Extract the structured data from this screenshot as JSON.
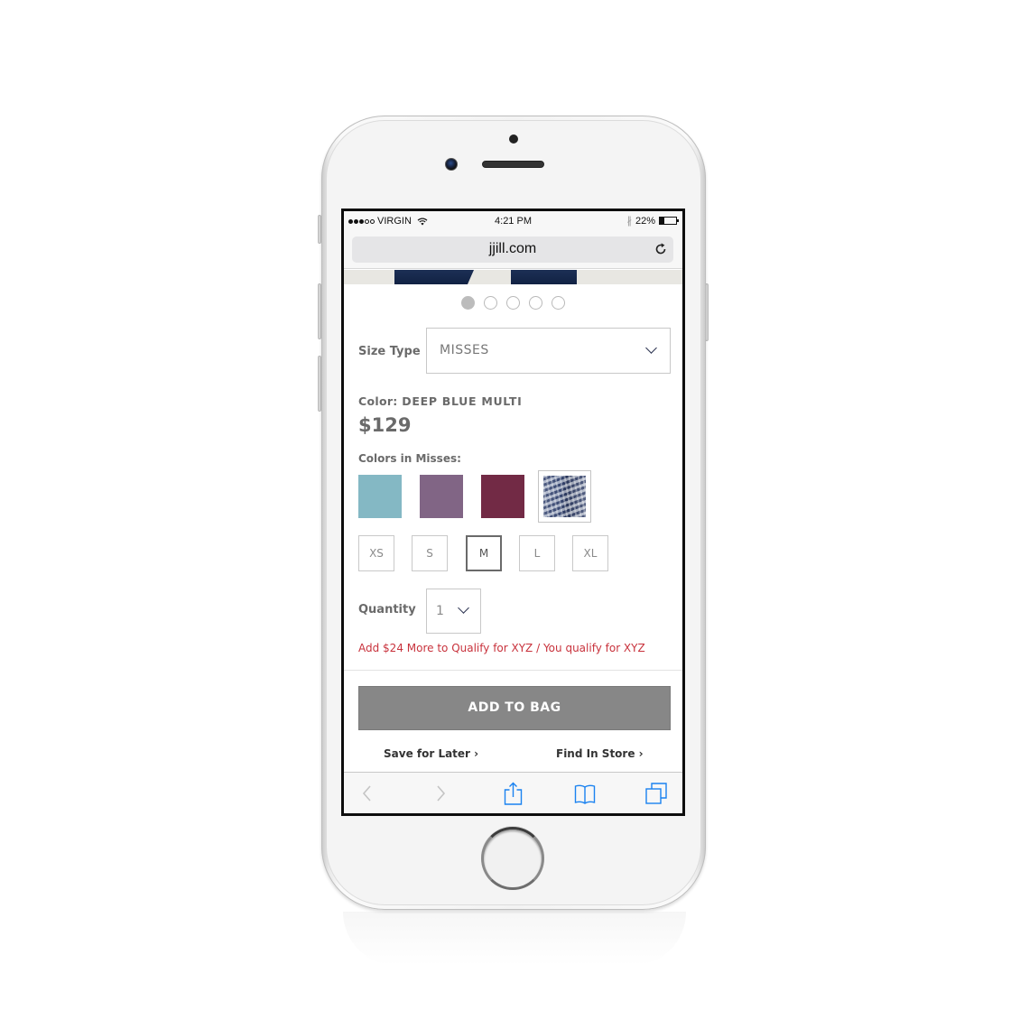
{
  "status_bar": {
    "carrier": "VIRGIN",
    "signal_bars_filled": 3,
    "signal_bars_total": 5,
    "time": "4:21 PM",
    "battery_percent": "22%",
    "icons": [
      "wifi-icon",
      "bluetooth-icon",
      "battery-icon"
    ]
  },
  "browser": {
    "url": "jjill.com",
    "reload_icon": "reload-icon",
    "toolbar": [
      "back-icon",
      "forward-icon",
      "share-icon",
      "bookmarks-icon",
      "tabs-icon"
    ]
  },
  "carousel": {
    "total_pages": 5,
    "active_page": 1
  },
  "product": {
    "size_type_label": "Size Type",
    "size_type_value": "MISSES",
    "color_label": "Color:",
    "color_name": "DEEP BLUE MULTI",
    "price": "$129",
    "colors_label": "Colors in Misses:",
    "swatches": [
      {
        "name": "teal",
        "color": "#84b8c4"
      },
      {
        "name": "purple",
        "color": "#816585"
      },
      {
        "name": "burgundy",
        "color": "#722a45"
      },
      {
        "name": "deep-blue-multi",
        "color": "#4a5b82",
        "selected": true
      }
    ],
    "sizes": [
      {
        "label": "XS"
      },
      {
        "label": "S"
      },
      {
        "label": "M",
        "selected": true
      },
      {
        "label": "L"
      },
      {
        "label": "XL"
      }
    ],
    "quantity_label": "Quantity",
    "quantity_value": "1",
    "promo_message": "Add $24 More to Qualify for XYZ / You qualify for XYZ",
    "promo_color": "#c8323c",
    "add_to_bag_label": "ADD TO BAG",
    "save_for_later_label": "Save for Later ›",
    "find_in_store_label": "Find In Store ›"
  }
}
